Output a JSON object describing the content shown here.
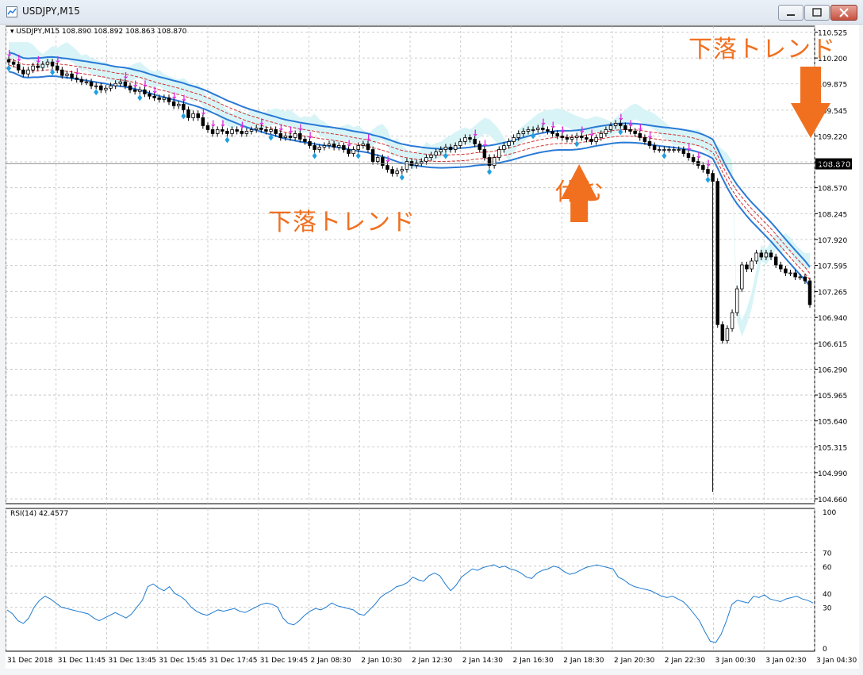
{
  "window": {
    "title": "USDJPY,M15"
  },
  "chart_data": {
    "type": "candlestick",
    "header": "USDJPY,M15  108.890 108.892 108.863 108.870",
    "price_axis": {
      "ticks": [
        "110.525",
        "110.200",
        "109.875",
        "109.545",
        "109.220",
        "108.895",
        "108.570",
        "108.245",
        "107.920",
        "107.595",
        "107.265",
        "106.940",
        "106.615",
        "106.290",
        "105.965",
        "105.640",
        "105.315",
        "104.990",
        "104.660"
      ],
      "current_price": "108.870",
      "range": [
        104.6,
        110.6
      ]
    },
    "time_axis": [
      "31 Dec 2018",
      "31 Dec 11:45",
      "31 Dec 13:45",
      "31 Dec 15:45",
      "31 Dec 17:45",
      "31 Dec 19:45",
      "2 Jan 08:30",
      "2 Jan 10:30",
      "2 Jan 12:30",
      "2 Jan 14:30",
      "2 Jan 16:30",
      "2 Jan 18:30",
      "2 Jan 20:30",
      "2 Jan 22:30",
      "3 Jan 00:30",
      "3 Jan 02:30",
      "3 Jan 04:30"
    ],
    "close": [
      110.15,
      110.12,
      110.05,
      110.0,
      110.05,
      110.1,
      110.08,
      110.12,
      110.15,
      110.1,
      110.05,
      109.98,
      110.0,
      109.95,
      109.93,
      109.9,
      109.9,
      109.85,
      109.85,
      109.8,
      109.82,
      109.85,
      109.88,
      109.9,
      109.85,
      109.8,
      109.78,
      109.8,
      109.75,
      109.72,
      109.7,
      109.68,
      109.7,
      109.65,
      109.6,
      109.62,
      109.55,
      109.45,
      109.5,
      109.45,
      109.35,
      109.3,
      109.25,
      109.3,
      109.28,
      109.25,
      109.3,
      109.28,
      109.25,
      109.28,
      109.3,
      109.32,
      109.3,
      109.28,
      109.3,
      109.25,
      109.2,
      109.22,
      109.2,
      109.25,
      109.18,
      109.15,
      109.1,
      109.05,
      109.08,
      109.1,
      109.12,
      109.08,
      109.1,
      109.05,
      109.0,
      109.05,
      109.1,
      109.12,
      109.05,
      108.9,
      108.95,
      108.85,
      108.8,
      108.75,
      108.78,
      108.8,
      108.9,
      108.85,
      108.88,
      108.9,
      108.95,
      108.98,
      109.02,
      109.05,
      109.08,
      109.05,
      109.1,
      109.15,
      109.2,
      109.18,
      109.12,
      109.05,
      108.95,
      108.85,
      108.95,
      109.05,
      109.1,
      109.15,
      109.2,
      109.25,
      109.28,
      109.3,
      109.3,
      109.32,
      109.3,
      109.28,
      109.25,
      109.22,
      109.2,
      109.18,
      109.2,
      109.22,
      109.2,
      109.18,
      109.15,
      109.2,
      109.25,
      109.3,
      109.35,
      109.38,
      109.35,
      109.3,
      109.28,
      109.25,
      109.2,
      109.15,
      109.1,
      109.05,
      109.05,
      109.05,
      109.05,
      109.05,
      109.05,
      109.0,
      108.95,
      108.9,
      108.85,
      108.8,
      108.75,
      108.65,
      106.85,
      106.65,
      106.8,
      107.0,
      107.3,
      107.6,
      107.55,
      107.65,
      107.75,
      107.7,
      107.75,
      107.7,
      107.6,
      107.55,
      107.5,
      107.5,
      107.45,
      107.45,
      107.4,
      107.1
    ],
    "series": [
      {
        "name": "envelope-upper",
        "color": "#2a7ad6"
      },
      {
        "name": "ma",
        "color": "#d03030"
      },
      {
        "name": "envelope-lower",
        "color": "#2a7ad6"
      },
      {
        "name": "kumo",
        "color": "#d4f3f6"
      }
    ],
    "rsi": {
      "label": "RSI(14) 42.4577",
      "levels": [
        "100",
        "70",
        "60",
        "40",
        "30",
        "0"
      ],
      "range": [
        0,
        100
      ],
      "values": [
        28,
        25,
        20,
        18,
        22,
        30,
        35,
        38,
        36,
        33,
        30,
        29,
        28,
        27,
        26,
        25,
        22,
        20,
        22,
        24,
        26,
        24,
        22,
        25,
        30,
        35,
        45,
        47,
        44,
        42,
        45,
        40,
        38,
        35,
        30,
        27,
        25,
        24,
        26,
        28,
        27,
        28,
        29,
        27,
        26,
        28,
        30,
        32,
        33,
        32,
        30,
        22,
        18,
        17,
        20,
        24,
        27,
        29,
        28,
        30,
        33,
        31,
        30,
        29,
        28,
        25,
        24,
        28,
        32,
        37,
        40,
        42,
        45,
        46,
        48,
        52,
        50,
        49,
        53,
        55,
        53,
        47,
        42,
        46,
        52,
        55,
        58,
        57,
        59,
        60,
        61,
        59,
        60,
        58,
        57,
        55,
        52,
        51,
        55,
        57,
        58,
        60,
        59,
        56,
        54,
        55,
        57,
        59,
        60,
        61,
        60,
        59,
        58,
        52,
        50,
        47,
        45,
        44,
        43,
        42,
        40,
        38,
        37,
        38,
        36,
        34,
        30,
        25,
        20,
        12,
        5,
        4,
        10,
        20,
        32,
        35,
        34,
        33,
        38,
        37,
        39,
        36,
        35,
        34,
        36,
        37,
        38,
        36,
        35,
        33
      ]
    },
    "arrow_up_x": 117,
    "arrow_down_x": 165
  },
  "annotations": {
    "a1": "下落トレンド",
    "a2": "下落トレンド",
    "a3": "休む"
  },
  "colors": {
    "pink_arrow": "#e020e0",
    "purple_arrow": "#9030d0",
    "cyan_diamond": "#20a0e0",
    "orange": "#f07020",
    "grid": "#c0c0c0"
  }
}
